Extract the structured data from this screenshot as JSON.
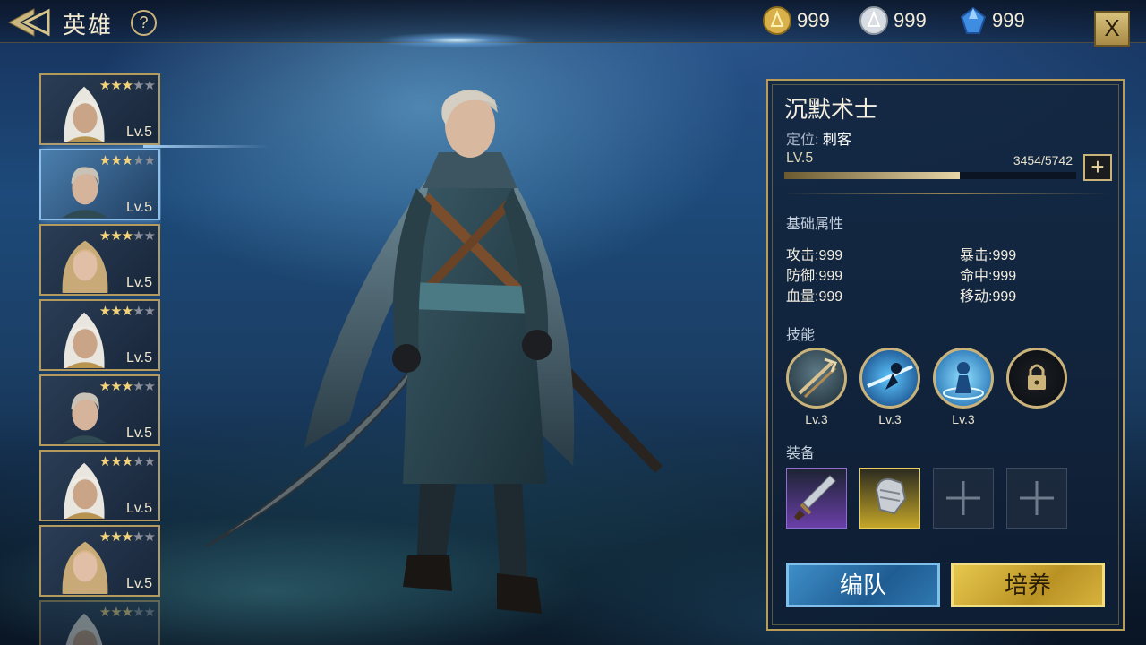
{
  "header": {
    "title": "英雄",
    "help": "?",
    "close": "X",
    "currencies": [
      {
        "name": "gold-coin-icon",
        "value": "999",
        "color": "#d8b14a"
      },
      {
        "name": "silver-coin-icon",
        "value": "999",
        "color": "#d7dde3"
      },
      {
        "name": "blue-gem-icon",
        "value": "999",
        "color": "#3f8de0"
      }
    ]
  },
  "hero_list": [
    {
      "level": "Lv.5",
      "stars": 3,
      "max_stars": 5,
      "portrait": "hooded-hero-portrait"
    },
    {
      "level": "Lv.5",
      "stars": 3,
      "max_stars": 5,
      "portrait": "silver-hair-hero-portrait",
      "selected": true
    },
    {
      "level": "Lv.5",
      "stars": 3,
      "max_stars": 5,
      "portrait": "blonde-hero-portrait"
    },
    {
      "level": "Lv.5",
      "stars": 3,
      "max_stars": 5,
      "portrait": "hooded-hero-portrait"
    },
    {
      "level": "Lv.5",
      "stars": 3,
      "max_stars": 5,
      "portrait": "silver-hair-hero-portrait"
    },
    {
      "level": "Lv.5",
      "stars": 3,
      "max_stars": 5,
      "portrait": "hooded-hero-portrait"
    },
    {
      "level": "Lv.5",
      "stars": 3,
      "max_stars": 5,
      "portrait": "blonde-hero-portrait"
    },
    {
      "level": "",
      "stars": 3,
      "max_stars": 5,
      "portrait": "hooded-hero-portrait"
    }
  ],
  "hero": {
    "name": "沉默术士",
    "role_label": "定位:",
    "role_value": "刺客",
    "level": "LV.5",
    "exp_text": "3454/5742",
    "exp_current": 3454,
    "exp_max": 5742,
    "exp_add": "+"
  },
  "attributes": {
    "title": "基础属性",
    "items": [
      {
        "label": "攻击:",
        "value": "999"
      },
      {
        "label": "暴击:",
        "value": "999"
      },
      {
        "label": "防御:",
        "value": "999"
      },
      {
        "label": "命中:",
        "value": "999"
      },
      {
        "label": "血量:",
        "value": "999"
      },
      {
        "label": "移动:",
        "value": "999"
      }
    ]
  },
  "skills": {
    "title": "技能",
    "items": [
      {
        "name": "crossbow-skill-icon",
        "level": "Lv.3"
      },
      {
        "name": "dash-strike-skill-icon",
        "level": "Lv.3"
      },
      {
        "name": "spirit-shield-skill-icon",
        "level": "Lv.3"
      },
      {
        "name": "lock-icon",
        "level": ""
      }
    ]
  },
  "equipment": {
    "title": "装备",
    "slots": [
      {
        "name": "dagger-icon",
        "rarity_color": "#6a3fa8"
      },
      {
        "name": "gauntlet-icon",
        "rarity_color": "#c4a628"
      },
      {
        "name": "add-icon",
        "empty": true
      },
      {
        "name": "add-icon",
        "empty": true
      }
    ]
  },
  "actions": {
    "team": "编队",
    "train": "培养"
  }
}
